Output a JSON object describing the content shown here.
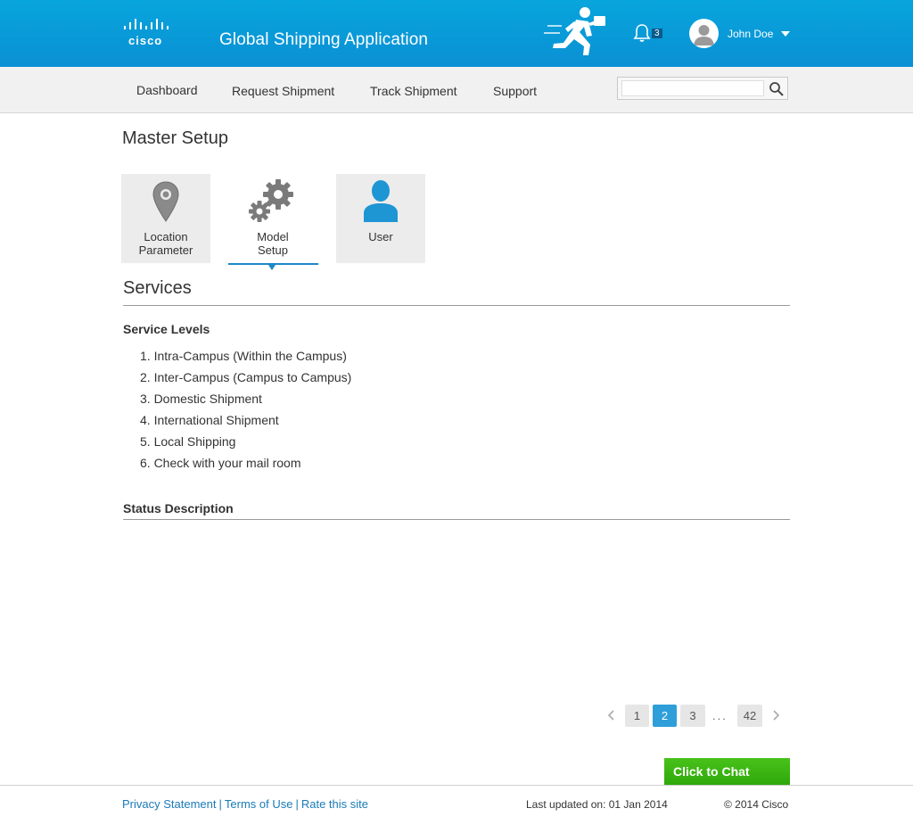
{
  "header": {
    "logo_text": "cisco",
    "app_title": "Global Shipping Application",
    "notification_count": "3",
    "user_name": "John Doe"
  },
  "nav": {
    "items": [
      {
        "label": "Dashboard"
      },
      {
        "label": "Request Shipment"
      },
      {
        "label": "Track Shipment"
      },
      {
        "label": "Support"
      }
    ],
    "search_placeholder": ""
  },
  "page": {
    "title": "Master Setup",
    "tiles": [
      {
        "line1": "Location",
        "line2": "Parameter",
        "icon": "location-pin-icon"
      },
      {
        "line1": "Model",
        "line2": "Setup",
        "icon": "gears-icon",
        "selected": true
      },
      {
        "line1": "User",
        "line2": "",
        "icon": "user-icon"
      }
    ],
    "section_title": "Services",
    "service_levels_heading": "Service Levels",
    "service_levels": [
      "1. Intra-Campus (Within the Campus)",
      "2. Inter-Campus (Campus to Campus)",
      "3. Domestic Shipment",
      "4. International Shipment",
      "5. Local Shipping",
      "6. Check with your mail room"
    ],
    "status_heading": "Status Description"
  },
  "pagination": {
    "pages": [
      "1",
      "2",
      "3"
    ],
    "ellipsis": "...",
    "last_page": "42",
    "current": "2"
  },
  "chat": {
    "label": "Click to Chat"
  },
  "footer": {
    "privacy": "Privacy Statement",
    "terms": "Terms of Use",
    "rate": "Rate this site",
    "separator": "|",
    "last_updated": "Last updated on: 01 Jan 2014",
    "copyright": "© 2014 Cisco"
  },
  "colors": {
    "header_blue": "#08a5dc",
    "accent_blue": "#1e88c7",
    "chat_green": "#3cb514",
    "link_blue": "#1a7bb8"
  }
}
